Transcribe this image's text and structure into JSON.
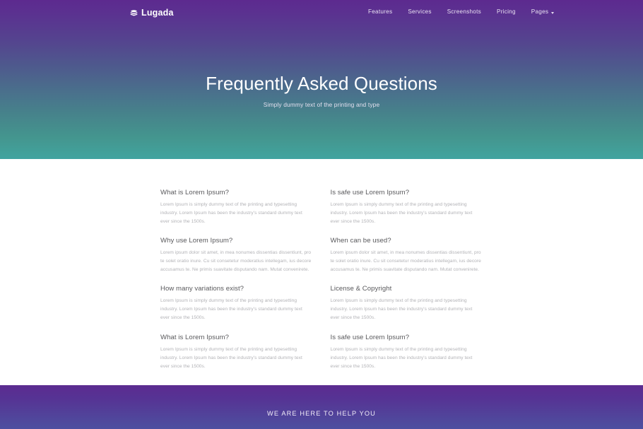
{
  "brand": {
    "name": "Lugada",
    "icon": "layers-icon"
  },
  "nav": {
    "items": [
      {
        "label": "Features"
      },
      {
        "label": "Services"
      },
      {
        "label": "Screenshots"
      },
      {
        "label": "Pricing"
      },
      {
        "label": "Pages",
        "caret": true
      }
    ]
  },
  "hero": {
    "title": "Frequently Asked Questions",
    "subtitle": "Simply dummy text of the printing and type"
  },
  "faq": {
    "items": [
      {
        "question": "What is Lorem Ipsum?",
        "answer": "Lorem Ipsum is simply dummy text of the printing and typesetting industry. Lorem Ipsum has been the industry's standard dummy text ever since the 1500s."
      },
      {
        "question": "Is safe use Lorem Ipsum?",
        "answer": "Lorem Ipsum is simply dummy text of the printing and typesetting industry. Lorem Ipsum has been the industry's standard dummy text ever since the 1500s."
      },
      {
        "question": "Why use Lorem Ipsum?",
        "answer": "Lorem ipsum dolor sit amet, in mea nonumes dissentias dissentiunt, pro te solet oratio inure. Cu sit consetetur moderatius intellegam, ius decore accusamus te. Ne primis suavitate disputando nam. Mutat convenirete."
      },
      {
        "question": "When can be used?",
        "answer": "Lorem ipsum dolor sit amet, in mea nonumes dissentias dissentiunt, pro te solet oratio inure. Cu sit consetetur moderatius intellegam, ius decore accusamus te. Ne primis suavitate disputando nam. Mutat convenirete."
      },
      {
        "question": "How many variations exist?",
        "answer": "Lorem Ipsum is simply dummy text of the printing and typesetting industry. Lorem Ipsum has been the industry's standard dummy text ever since the 1500s."
      },
      {
        "question": "License & Copyright",
        "answer": "Lorem Ipsum is simply dummy text of the printing and typesetting industry. Lorem Ipsum has been the industry's standard dummy text ever since the 1500s."
      },
      {
        "question": "What is Lorem Ipsum?",
        "answer": "Lorem Ipsum is simply dummy text of the printing and typesetting industry. Lorem Ipsum has been the industry's standard dummy text ever since the 1500s."
      },
      {
        "question": "Is safe use Lorem Ipsum?",
        "answer": "Lorem Ipsum is simply dummy text of the printing and typesetting industry. Lorem Ipsum has been the industry's standard dummy text ever since the 1500s."
      }
    ]
  },
  "cta": {
    "heading": "WE ARE HERE TO HELP YOU"
  },
  "colors": {
    "hero_gradient_start": "#5d2a8f",
    "hero_gradient_end": "#41a3a0",
    "cta_gradient_start": "#5c2b90",
    "cta_gradient_end": "#4d4fa0",
    "heading_text": "#59595c",
    "body_text": "#b2b2b6",
    "nav_text": "#e9e2f2"
  }
}
